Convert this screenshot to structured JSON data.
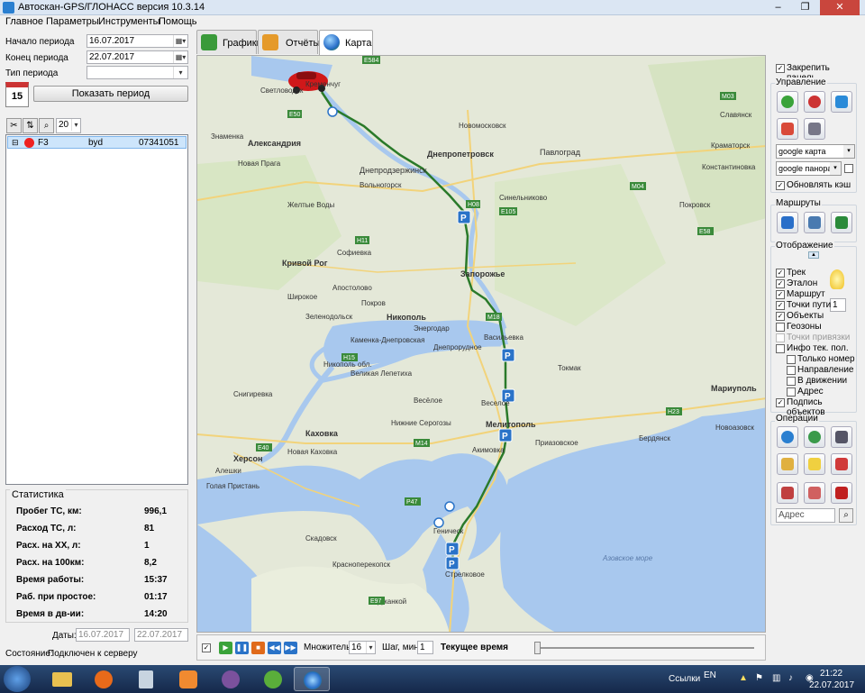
{
  "window": {
    "title": "Автоскан-GPS/ГЛОНАСС версия 10.3.14",
    "minimize": "–",
    "maximize": "❐",
    "close": "✕"
  },
  "menu": [
    "Главное",
    "Параметры",
    "Инструменты",
    "Помощь"
  ],
  "left": {
    "period_start_label": "Начало периода",
    "period_start_value": "16.07.2017",
    "period_end_label": "Конец периода",
    "period_end_value": "22.07.2017",
    "period_type_label": "Тип периода",
    "period_type_value": "",
    "calendar_day": "15",
    "show_period_button": "Показать период",
    "page_size": "20",
    "objects": [
      {
        "name": "F3",
        "model": "byd",
        "id": "07341051"
      }
    ]
  },
  "stats": {
    "title": "Статистика",
    "rows": [
      {
        "label": "Пробег ТС, км:",
        "value": "996,1"
      },
      {
        "label": "Расход ТС, л:",
        "value": "81"
      },
      {
        "label": "Расх. на ХХ, л:",
        "value": "1"
      },
      {
        "label": "Расх. на 100км:",
        "value": "8,2"
      },
      {
        "label": "Время работы:",
        "value": "15:37"
      },
      {
        "label": "Раб. при простое:",
        "value": "01:17"
      },
      {
        "label": "Время в дв-ии:",
        "value": "14:20"
      }
    ],
    "dates_label": "Даты:",
    "date_from": "16.07.2017",
    "date_to": "22.07.2017"
  },
  "status": {
    "label": "Состояние:",
    "value": "Подключен к серверу"
  },
  "tabs": [
    {
      "label": "Графики",
      "color": "#3a9a3a"
    },
    {
      "label": "Отчёты",
      "color": "#e59a2a"
    },
    {
      "label": "Карта",
      "color": "#2a6fc9"
    }
  ],
  "map": {
    "cities": [
      {
        "name": "Светловодск",
        "bold": false
      },
      {
        "name": "Александрия",
        "bold": true
      },
      {
        "name": "Кременчуг",
        "bold": false
      },
      {
        "name": "Днепродзержинск",
        "bold": false
      },
      {
        "name": "Днепропетровск",
        "bold": true
      },
      {
        "name": "Новомосковск",
        "bold": false
      },
      {
        "name": "Павлоград",
        "bold": false
      },
      {
        "name": "Краматорск",
        "bold": false
      },
      {
        "name": "Славянск",
        "bold": false
      },
      {
        "name": "Константиновка",
        "bold": false
      },
      {
        "name": "Покровск",
        "bold": false
      },
      {
        "name": "Синельниково",
        "bold": false
      },
      {
        "name": "Кривой Рог",
        "bold": true
      },
      {
        "name": "Запорожье",
        "bold": true
      },
      {
        "name": "Никополь",
        "bold": true
      },
      {
        "name": "Энергодар",
        "bold": false
      },
      {
        "name": "Каменка-Днепровская",
        "bold": false
      },
      {
        "name": "Днепрорудное",
        "bold": false
      },
      {
        "name": "Васильевка",
        "bold": false
      },
      {
        "name": "Токмак",
        "bold": false
      },
      {
        "name": "Мариуполь",
        "bold": true
      },
      {
        "name": "Мелитополь",
        "bold": true
      },
      {
        "name": "Бердянск",
        "bold": false
      },
      {
        "name": "Каховка",
        "bold": true
      },
      {
        "name": "Херсон",
        "bold": true
      },
      {
        "name": "Геническ",
        "bold": false
      },
      {
        "name": "Весёлое",
        "bold": false
      },
      {
        "name": "Приазовское",
        "bold": false
      },
      {
        "name": "Акимовка",
        "bold": false
      },
      {
        "name": "Джанкой",
        "bold": false
      },
      {
        "name": "Красноперекопск",
        "bold": false
      },
      {
        "name": "Стрелковое",
        "bold": false
      },
      {
        "name": "Азовское море",
        "bold": false
      },
      {
        "name": "Никополь обл.",
        "bold": false
      },
      {
        "name": "Новая Прага",
        "bold": false
      },
      {
        "name": "Знаменка",
        "bold": false
      },
      {
        "name": "Вольногорск",
        "bold": false
      },
      {
        "name": "Желтые Воды",
        "bold": false
      },
      {
        "name": "Софиевка",
        "bold": false
      },
      {
        "name": "Широкое",
        "bold": false
      },
      {
        "name": "Апостолово",
        "bold": false
      },
      {
        "name": "Покров",
        "bold": false
      },
      {
        "name": "Зеленодольск",
        "bold": false
      },
      {
        "name": "Снигиревка",
        "bold": false
      },
      {
        "name": "Новая Каховка",
        "bold": false
      },
      {
        "name": "Нижние Серогозы",
        "bold": false
      },
      {
        "name": "Великая Лепетиха",
        "bold": false
      },
      {
        "name": "Веселое",
        "bold": false
      },
      {
        "name": "Скадовск",
        "bold": false
      },
      {
        "name": "Алешки",
        "bold": false
      },
      {
        "name": "Голая Пристань",
        "bold": false
      },
      {
        "name": "Новоазовск",
        "bold": false
      }
    ],
    "roads": [
      "E584",
      "E50",
      "H08",
      "E105",
      "H11",
      "M14",
      "E97",
      "M03",
      "M04",
      "E58",
      "M18",
      "E40",
      "H15",
      "P47",
      "H23"
    ],
    "parking_label": "P"
  },
  "player": {
    "multiplier_label": "Множитель",
    "multiplier_value": "16",
    "step_label": "Шаг, мин",
    "step_value": "1",
    "current_time_label": "Текущее время",
    "slider_value": 0
  },
  "right": {
    "pin_panel": "Закрепить панель",
    "control_title": "Управление",
    "map_source": "google карта",
    "panorama": "google панорам",
    "refresh_cache": "Обновлять кэш",
    "routes_title": "Маршруты",
    "display_title": "Отображение",
    "display_items": [
      {
        "label": "Трек",
        "checked": true,
        "indent": false,
        "disabled": false
      },
      {
        "label": "Эталон",
        "checked": true,
        "indent": false,
        "disabled": false
      },
      {
        "label": "Маршрут",
        "checked": true,
        "indent": false,
        "disabled": false
      },
      {
        "label": "Точки пути",
        "checked": true,
        "indent": false,
        "disabled": false
      },
      {
        "label": "Объекты",
        "checked": true,
        "indent": false,
        "disabled": false
      },
      {
        "label": "Геозоны",
        "checked": false,
        "indent": false,
        "disabled": false
      },
      {
        "label": "Точки привязки",
        "checked": false,
        "indent": false,
        "disabled": true
      },
      {
        "label": "Инфо тек. пол.",
        "checked": false,
        "indent": false,
        "disabled": false
      },
      {
        "label": "Только номер",
        "checked": false,
        "indent": true,
        "disabled": false
      },
      {
        "label": "Направление",
        "checked": false,
        "indent": true,
        "disabled": false
      },
      {
        "label": "В движении",
        "checked": false,
        "indent": true,
        "disabled": false
      },
      {
        "label": "Адрес",
        "checked": false,
        "indent": true,
        "disabled": false
      },
      {
        "label": "Подпись объектов",
        "checked": true,
        "indent": false,
        "disabled": false
      }
    ],
    "waypoints_value": "1",
    "operations_title": "Операции",
    "address_label": "Адрес"
  },
  "taskbar": {
    "links_label": "Ссылки",
    "lang": "EN",
    "time": "21:22",
    "date": "22.07.2017"
  }
}
